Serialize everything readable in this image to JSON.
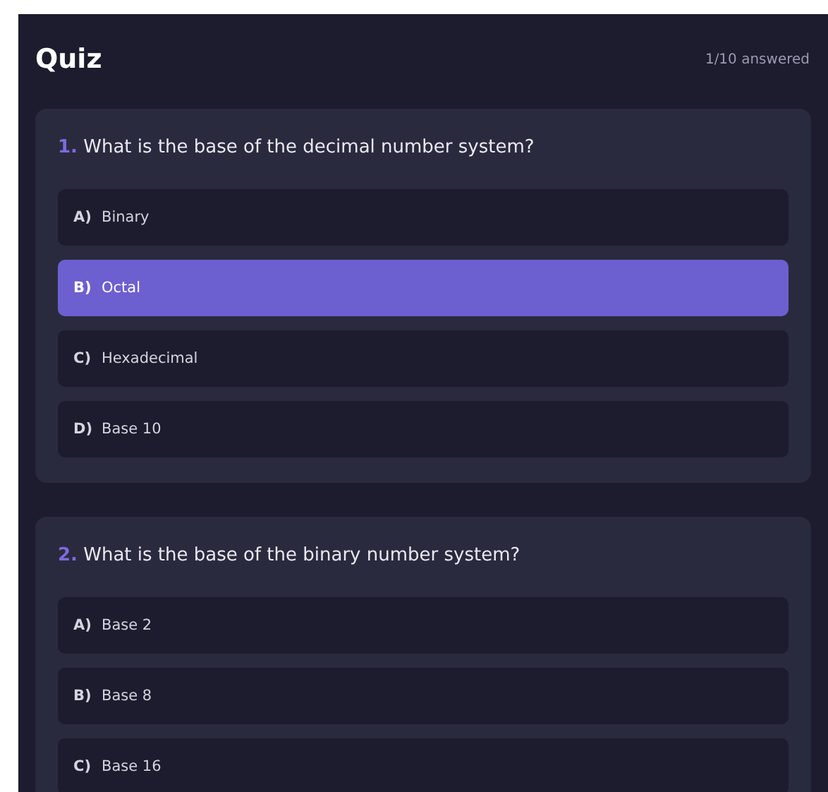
{
  "header": {
    "title": "Quiz",
    "progress": "1/10 answered"
  },
  "questions": [
    {
      "number": "1.",
      "text": "What is the base of the decimal number system?",
      "options": [
        {
          "letter": "A)",
          "text": "Binary",
          "selected": false
        },
        {
          "letter": "B)",
          "text": "Octal",
          "selected": true
        },
        {
          "letter": "C)",
          "text": "Hexadecimal",
          "selected": false
        },
        {
          "letter": "D)",
          "text": "Base 10",
          "selected": false
        }
      ]
    },
    {
      "number": "2.",
      "text": "What is the base of the binary number system?",
      "options": [
        {
          "letter": "A)",
          "text": "Base 2",
          "selected": false
        },
        {
          "letter": "B)",
          "text": "Base 8",
          "selected": false
        },
        {
          "letter": "C)",
          "text": "Base 16",
          "selected": false
        }
      ]
    }
  ]
}
